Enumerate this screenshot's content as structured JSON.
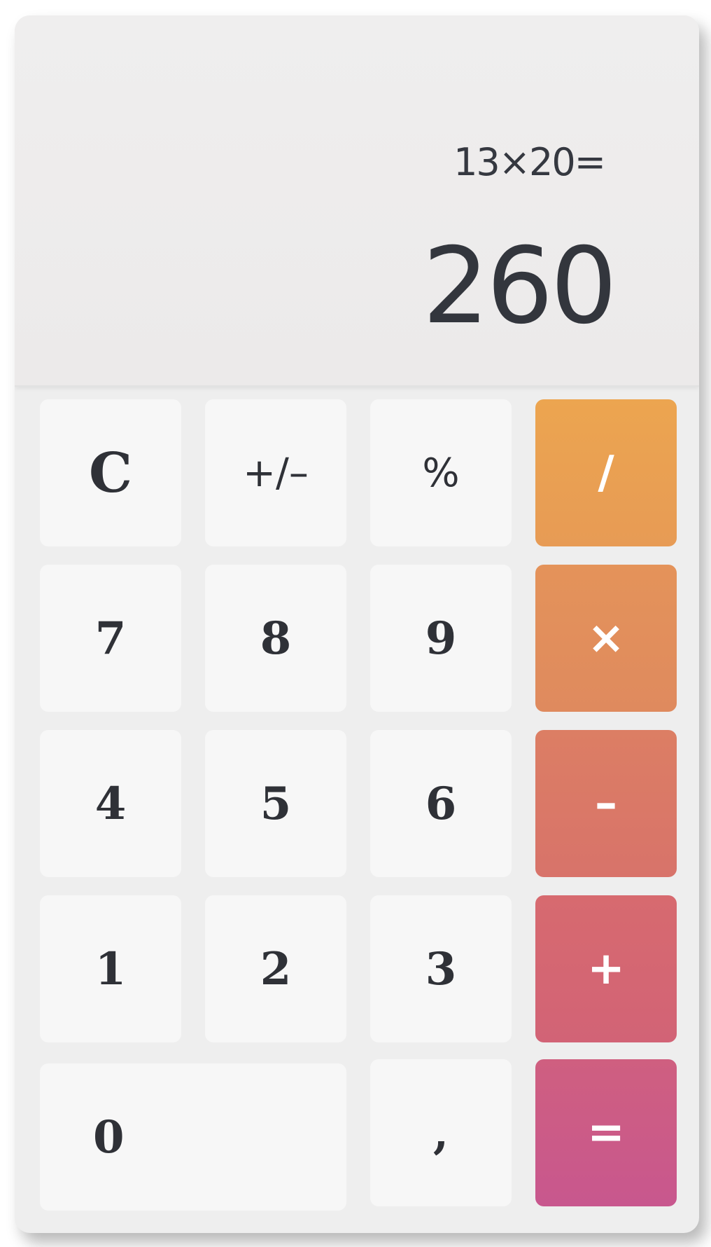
{
  "display": {
    "expression": "13×20=",
    "result": "260"
  },
  "keys": {
    "clear": "C",
    "sign": "+/–",
    "percent": "%",
    "divide": "/",
    "seven": "7",
    "eight": "8",
    "nine": "9",
    "multiply": "×",
    "four": "4",
    "five": "5",
    "six": "6",
    "subtract": "–",
    "one": "1",
    "two": "2",
    "three": "3",
    "add": "+",
    "zero": "0",
    "decimal": ",",
    "equals": "="
  },
  "colors": {
    "divide": "#eca251",
    "multiply": "#e28d5a",
    "subtract": "#da7866",
    "add": "#d46570",
    "equals": "#ca5a8b",
    "key_background": "#f7f7f7",
    "panel_background": "#eeeeee"
  }
}
